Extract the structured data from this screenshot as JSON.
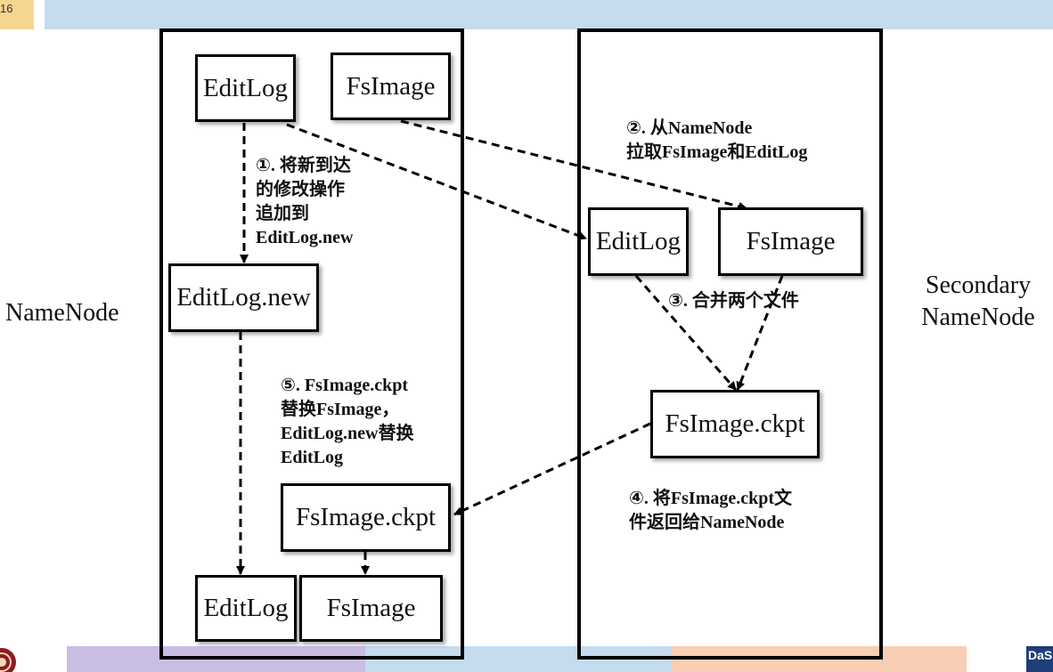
{
  "slide": {
    "page_number": "16"
  },
  "labels": {
    "namenode": "NameNode",
    "secondary_line1": "Secondary",
    "secondary_line2": "NameNode"
  },
  "boxes": {
    "nn_editlog": "EditLog",
    "nn_fsimage": "FsImage",
    "nn_editlog_new": "EditLog.new",
    "nn_fsimage_ckpt": "FsImage.ckpt",
    "nn_editlog_final": "EditLog",
    "nn_fsimage_final": "FsImage",
    "snn_editlog": "EditLog",
    "snn_fsimage": "FsImage",
    "snn_fsimage_ckpt": "FsImage.ckpt"
  },
  "steps": {
    "step1": [
      "①. 将新到达",
      "的修改操作",
      "追加到",
      "EditLog.new"
    ],
    "step2": [
      "②. 从NameNode",
      "拉取FsImage和EditLog"
    ],
    "step3": "③. 合并两个文件",
    "step4": [
      "④. 将FsImage.ckpt文",
      "件返回给NameNode"
    ],
    "step5": [
      "⑤. FsImage.ckpt",
      "替换FsImage，",
      "EditLog.new替换",
      "EditLog"
    ]
  },
  "logos": {
    "right": "DaS"
  },
  "colors": {
    "top_bar": "#c5dbee",
    "page_number_bg": "#f5d58f",
    "bottom_bar_1": "#c9bde3",
    "bottom_bar_2": "#c5dbee",
    "bottom_bar_3": "#f8ceb4"
  }
}
